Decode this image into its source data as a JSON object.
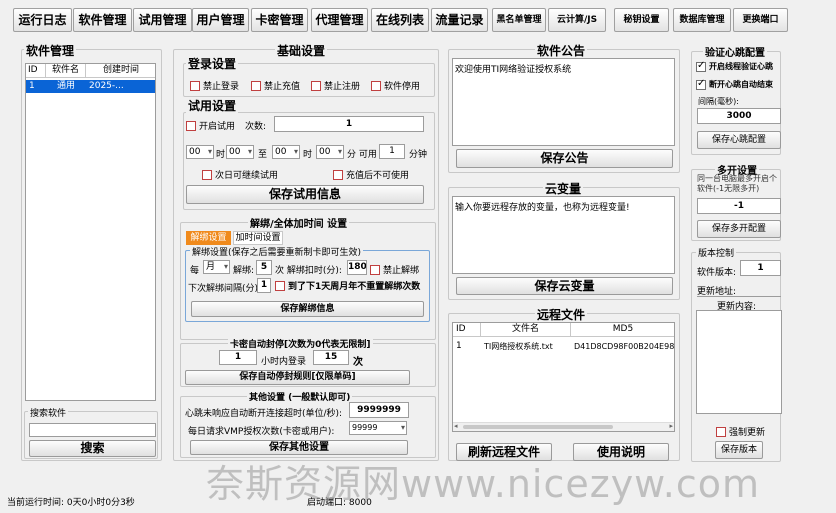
{
  "tabs": [
    "运行日志",
    "软件管理",
    "试用管理",
    "用户管理",
    "卡密管理",
    "代理管理",
    "在线列表",
    "流量记录",
    "黑名单管理",
    "云计算/JS",
    "秘钥设置",
    "数据库管理",
    "更换端口"
  ],
  "software": {
    "title": "软件管理",
    "columns": [
      "ID",
      "软件名",
      "创建时间"
    ],
    "rows": [
      [
        "1",
        "通用",
        "2025-..."
      ]
    ],
    "search_label": "搜索软件",
    "search_value": "",
    "search_button": "搜索"
  },
  "basic": {
    "title": "基础设置",
    "login": {
      "title": "登录设置",
      "options": [
        "禁止登录",
        "禁止充值",
        "禁止注册",
        "软件停用"
      ]
    },
    "trial": {
      "title": "试用设置",
      "enable": "开启试用",
      "count_label": "次数:",
      "count_value": "1",
      "t1": "00",
      "hour": "时",
      "t2": "00",
      "to": "至",
      "t3": "00",
      "t4": "00",
      "minute_available": "分 可用",
      "minutes": "1",
      "minute_unit": "分钟",
      "next_day": "次日可继续试用",
      "after_recharge": "充值后不可使用",
      "save": "保存试用信息"
    },
    "unbind": {
      "title": "解绑/全体加时间 设置",
      "tab_active": "解绑设置",
      "tab_other": "加时间设置",
      "note": "解绑设置(保存之后需要重新制卡即可生效)",
      "period": "月",
      "per_label": "每",
      "unbind_label": "解绑:",
      "unbind_value": "5",
      "deduct_label": "次 解绑扣时(分):",
      "deduct_value": "180",
      "forbid": "禁止解绑",
      "interval_label": "下次解绑间隔(分)",
      "interval_value": "1",
      "reset": "到了下1天周月年不重置解绑次数",
      "save": "保存解绑信息"
    },
    "autoban": {
      "title": "卡密自动封停[次数为0代表无限制]",
      "value1": "1",
      "hours_label": "小时内登录",
      "value2": "15",
      "times_label": "次",
      "save": "保存自动停封规则[仅限单码]"
    },
    "other": {
      "title": "其他设置 (一般默认即可)",
      "timeout_label": "心跳未响应自动断开连接超时(单位/秒):",
      "timeout_value": "9999999",
      "vmp_label": "每日请求VMP授权次数(卡密或用户):",
      "vmp_value": "99999",
      "save": "保存其他设置"
    }
  },
  "notice": {
    "title": "软件公告",
    "content": "欢迎使用TI网络验证授权系统",
    "save": "保存公告"
  },
  "cloudvar": {
    "title": "云变量",
    "content": "输入你要远程存放的变量，也称为远程变量!",
    "save": "保存云变量"
  },
  "remote": {
    "title": "远程文件",
    "columns": [
      "ID",
      "文件名",
      "MD5"
    ],
    "rows": [
      [
        "1",
        "TI网络授权系统.txt",
        "D41D8CD98F00B204E980..."
      ]
    ],
    "refresh": "刷新远程文件",
    "help": "使用说明"
  },
  "heartbeat": {
    "title": "验证心跳配置",
    "opt1": "开启线程验证心跳",
    "opt2": "断开心跳自动结束",
    "interval_label": "间隔(毫秒):",
    "interval_value": "3000",
    "save": "保存心跳配置"
  },
  "multi": {
    "title": "多开设置",
    "desc": "同一台电脑最多开启个软件(-1无限多开)",
    "value": "-1",
    "save": "保存多开配置"
  },
  "version": {
    "title": "版本控制",
    "ver_label": "软件版本:",
    "ver_value": "1",
    "url_label": "更新地址:",
    "url_value": "",
    "content_label": "更新内容:",
    "force": "强制更新",
    "save": "保存版本"
  },
  "status": {
    "runtime": "当前运行时间: 0天0小时0分3秒",
    "port": "启动端口: 8000"
  },
  "watermark": "奈斯资源网www.nicezyw.com"
}
